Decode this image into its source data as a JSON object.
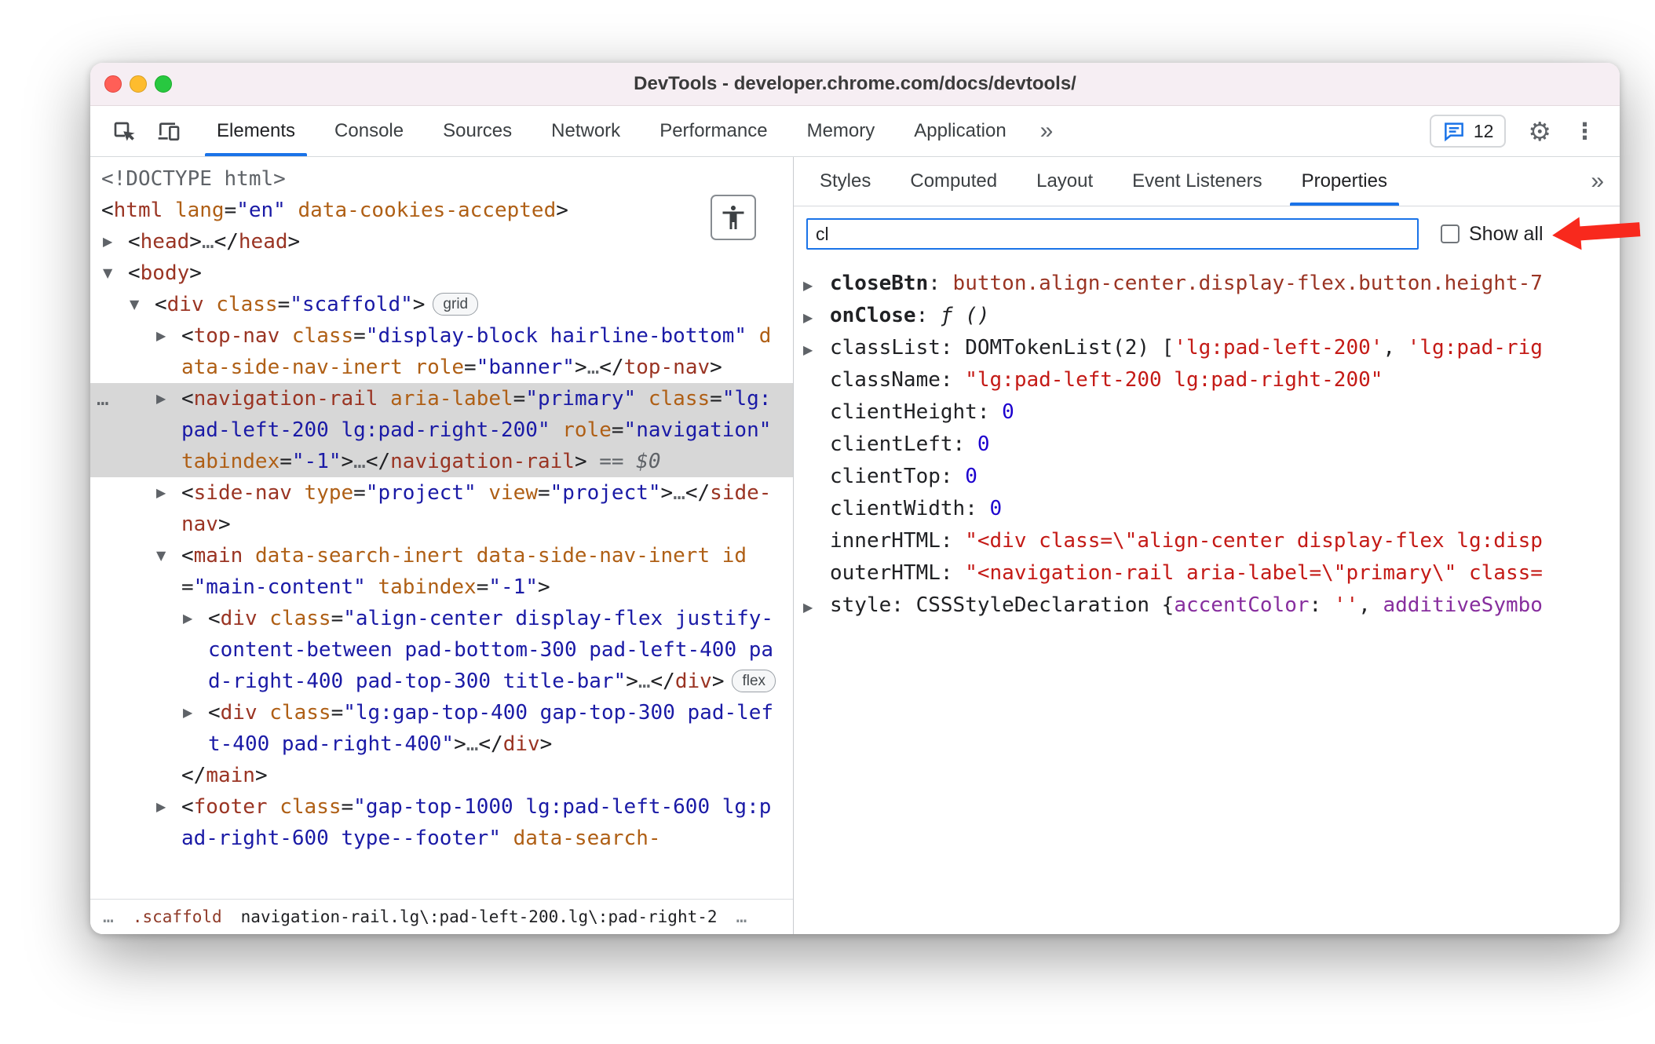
{
  "window": {
    "title": "DevTools - developer.chrome.com/docs/devtools/"
  },
  "icons": {
    "gear": "⚙",
    "kebab": "⋮",
    "inspect": "inspect-cursor",
    "device": "device-toolbar",
    "chat": "chat-bubble",
    "accessibility": "accessibility-person"
  },
  "toolbar": {
    "tabs": [
      "Elements",
      "Console",
      "Sources",
      "Network",
      "Performance",
      "Memory",
      "Application"
    ],
    "selected_tab": "Elements",
    "more_tabs": "»",
    "chat_count": "12"
  },
  "side_panel": {
    "tabs": [
      "Styles",
      "Computed",
      "Layout",
      "Event Listeners",
      "Properties"
    ],
    "selected_tab": "Properties",
    "more": "»"
  },
  "filter": {
    "value": "cl",
    "show_all_label": "Show all",
    "show_all_checked": false
  },
  "properties": [
    {
      "expand": true,
      "bold": true,
      "name": "closeBtn",
      "value": [
        [
          "node",
          "button.align-center.display-flex.button.height-7"
        ]
      ]
    },
    {
      "expand": true,
      "bold": true,
      "name": "onClose",
      "value": [
        [
          "fn",
          "ƒ ()"
        ]
      ]
    },
    {
      "expand": true,
      "bold": false,
      "name": "classList",
      "value": [
        [
          "obj",
          "DOMTokenList(2) "
        ],
        [
          "pn",
          "["
        ],
        [
          "str",
          "'lg:pad-left-200'"
        ],
        [
          "pn",
          ", "
        ],
        [
          "str",
          "'lg:pad-rig"
        ]
      ]
    },
    {
      "name": "className",
      "value": [
        [
          "str",
          "\"lg:pad-left-200 lg:pad-right-200\""
        ]
      ]
    },
    {
      "name": "clientHeight",
      "value": [
        [
          "num",
          "0"
        ]
      ]
    },
    {
      "name": "clientLeft",
      "value": [
        [
          "num",
          "0"
        ]
      ]
    },
    {
      "name": "clientTop",
      "value": [
        [
          "num",
          "0"
        ]
      ]
    },
    {
      "name": "clientWidth",
      "value": [
        [
          "num",
          "0"
        ]
      ]
    },
    {
      "name": "innerHTML",
      "value": [
        [
          "str",
          "\"<div class=\\\"align-center display-flex lg:disp"
        ]
      ]
    },
    {
      "name": "outerHTML",
      "value": [
        [
          "str",
          "\"<navigation-rail aria-label=\\\"primary\\\" class="
        ]
      ]
    },
    {
      "expand": true,
      "name": "style",
      "value": [
        [
          "obj",
          "CSSStyleDeclaration "
        ],
        [
          "pn",
          "{"
        ],
        [
          "key",
          "accentColor"
        ],
        [
          "pn",
          ": "
        ],
        [
          "str",
          "''"
        ],
        [
          "pn",
          ", "
        ],
        [
          "key",
          "additiveSymbo"
        ]
      ]
    }
  ],
  "dom_tree": {
    "rows": [
      {
        "lvl": 0,
        "seg": [
          [
            "doc",
            "<!DOCTYPE html>"
          ]
        ]
      },
      {
        "lvl": 0,
        "seg": [
          [
            "pn",
            "<"
          ],
          [
            "tag",
            "html"
          ],
          [
            "pn",
            " "
          ],
          [
            "attr",
            "lang"
          ],
          [
            "pn",
            "="
          ],
          [
            "val",
            "\"en\""
          ],
          [
            "pn",
            " "
          ],
          [
            "attr",
            "data-cookies-accepted"
          ],
          [
            "pn",
            ">"
          ]
        ]
      },
      {
        "lvl": 1,
        "arrow": "c",
        "seg": [
          [
            "pn",
            "<"
          ],
          [
            "tag",
            "head"
          ],
          [
            "pn",
            ">"
          ],
          [
            "ell",
            "…"
          ],
          [
            "pn",
            "</"
          ],
          [
            "tag",
            "head"
          ],
          [
            "pn",
            ">"
          ]
        ]
      },
      {
        "lvl": 1,
        "arrow": "o",
        "seg": [
          [
            "pn",
            "<"
          ],
          [
            "tag",
            "body"
          ],
          [
            "pn",
            ">"
          ]
        ]
      },
      {
        "lvl": 2,
        "arrow": "o",
        "badge": "grid",
        "seg": [
          [
            "pn",
            "<"
          ],
          [
            "tag",
            "div"
          ],
          [
            "pn",
            " "
          ],
          [
            "attr",
            "class"
          ],
          [
            "pn",
            "="
          ],
          [
            "val",
            "\"scaffold\""
          ],
          [
            "pn",
            ">"
          ]
        ]
      },
      {
        "lvl": 3,
        "arrow": "c",
        "seg": [
          [
            "pn",
            "<"
          ],
          [
            "tag",
            "top-nav"
          ],
          [
            "pn",
            " "
          ],
          [
            "attr",
            "class"
          ],
          [
            "pn",
            "="
          ],
          [
            "val",
            "\"display-block hairline-bottom\""
          ],
          [
            "pn",
            " "
          ],
          [
            "attr",
            "data-side-nav-inert"
          ],
          [
            "pn",
            " "
          ],
          [
            "attr",
            "role"
          ],
          [
            "pn",
            "="
          ],
          [
            "val",
            "\"banner\""
          ],
          [
            "pn",
            ">"
          ],
          [
            "ell",
            "…"
          ],
          [
            "pn",
            "</"
          ],
          [
            "tag",
            "top-nav"
          ],
          [
            "pn",
            ">"
          ]
        ]
      },
      {
        "lvl": 3,
        "arrow": "c",
        "sel": true,
        "gutter": "…",
        "seg": [
          [
            "pn",
            "<"
          ],
          [
            "tag",
            "navigation-rail"
          ],
          [
            "pn",
            " "
          ],
          [
            "attr",
            "aria-label"
          ],
          [
            "pn",
            "="
          ],
          [
            "val",
            "\"primary\""
          ],
          [
            "pn",
            " "
          ],
          [
            "attr",
            "class"
          ],
          [
            "pn",
            "="
          ],
          [
            "val",
            "\"lg:pad-left-200 lg:pad-right-200\""
          ],
          [
            "pn",
            " "
          ],
          [
            "attr",
            "role"
          ],
          [
            "pn",
            "="
          ],
          [
            "val",
            "\"navigation\""
          ],
          [
            "pn",
            " "
          ],
          [
            "attr",
            "tabindex"
          ],
          [
            "pn",
            "="
          ],
          [
            "val",
            "\"-1\""
          ],
          [
            "pn",
            ">"
          ],
          [
            "ell",
            "…"
          ],
          [
            "pn",
            "</"
          ],
          [
            "tag",
            "navigation-rail"
          ],
          [
            "pn",
            ">"
          ],
          [
            "eq",
            " == "
          ],
          [
            "dollar",
            "$0"
          ]
        ]
      },
      {
        "lvl": 3,
        "arrow": "c",
        "seg": [
          [
            "pn",
            "<"
          ],
          [
            "tag",
            "side-nav"
          ],
          [
            "pn",
            " "
          ],
          [
            "attr",
            "type"
          ],
          [
            "pn",
            "="
          ],
          [
            "val",
            "\"project\""
          ],
          [
            "pn",
            " "
          ],
          [
            "attr",
            "view"
          ],
          [
            "pn",
            "="
          ],
          [
            "val",
            "\"project\""
          ],
          [
            "pn",
            ">"
          ],
          [
            "ell",
            "…"
          ],
          [
            "pn",
            "</"
          ],
          [
            "tag",
            "side-nav"
          ],
          [
            "pn",
            ">"
          ]
        ]
      },
      {
        "lvl": 3,
        "arrow": "o",
        "seg": [
          [
            "pn",
            "<"
          ],
          [
            "tag",
            "main"
          ],
          [
            "pn",
            " "
          ],
          [
            "attr",
            "data-search-inert"
          ],
          [
            "pn",
            " "
          ],
          [
            "attr",
            "data-side-nav-inert"
          ],
          [
            "pn",
            " "
          ],
          [
            "attr",
            "id"
          ],
          [
            "pn",
            "="
          ],
          [
            "val",
            "\"main-content\""
          ],
          [
            "pn",
            " "
          ],
          [
            "attr",
            "tabindex"
          ],
          [
            "pn",
            "="
          ],
          [
            "val",
            "\"-1\""
          ],
          [
            "pn",
            ">"
          ]
        ]
      },
      {
        "lvl": 4,
        "arrow": "c",
        "badge": "flex",
        "seg": [
          [
            "pn",
            "<"
          ],
          [
            "tag",
            "div"
          ],
          [
            "pn",
            " "
          ],
          [
            "attr",
            "class"
          ],
          [
            "pn",
            "="
          ],
          [
            "val",
            "\"align-center display-flex justify-content-between pad-bottom-300 pad-left-400 pad-right-400 pad-top-300 title-bar\""
          ],
          [
            "pn",
            ">"
          ],
          [
            "ell",
            "…"
          ],
          [
            "pn",
            "</"
          ],
          [
            "tag",
            "div"
          ],
          [
            "pn",
            ">"
          ]
        ]
      },
      {
        "lvl": 4,
        "arrow": "c",
        "seg": [
          [
            "pn",
            "<"
          ],
          [
            "tag",
            "div"
          ],
          [
            "pn",
            " "
          ],
          [
            "attr",
            "class"
          ],
          [
            "pn",
            "="
          ],
          [
            "val",
            "\"lg:gap-top-400 gap-top-300 pad-left-400 pad-right-400\""
          ],
          [
            "pn",
            ">"
          ],
          [
            "ell",
            "…"
          ],
          [
            "pn",
            "</"
          ],
          [
            "tag",
            "div"
          ],
          [
            "pn",
            ">"
          ]
        ]
      },
      {
        "lvl": 3,
        "seg": [
          [
            "pn",
            "</"
          ],
          [
            "tag",
            "main"
          ],
          [
            "pn",
            ">"
          ]
        ]
      },
      {
        "lvl": 3,
        "arrow": "c",
        "seg": [
          [
            "pn",
            "<"
          ],
          [
            "tag",
            "footer"
          ],
          [
            "pn",
            " "
          ],
          [
            "attr",
            "class"
          ],
          [
            "pn",
            "="
          ],
          [
            "val",
            "\"gap-top-1000 lg:pad-left-600 lg:pad-right-600 type--footer\""
          ],
          [
            "pn",
            " "
          ],
          [
            "attr",
            "data-search-"
          ]
        ]
      }
    ]
  },
  "breadcrumbs": {
    "left_overflow": "…",
    "items": [
      {
        "label": ".scaffold",
        "selected": false
      },
      {
        "label": "navigation-rail.lg\\:pad-left-200.lg\\:pad-right-2",
        "selected": true
      }
    ],
    "right_overflow": "…"
  }
}
